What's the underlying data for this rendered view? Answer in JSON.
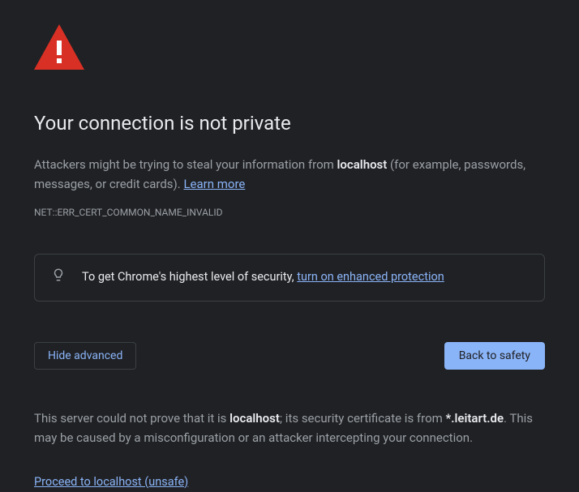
{
  "title": "Your connection is not private",
  "description": {
    "prefix": "Attackers might be trying to steal your information from ",
    "host": "localhost",
    "suffix": " (for example, passwords, messages, or credit cards). ",
    "learn_more": "Learn more"
  },
  "error_code": "NET::ERR_CERT_COMMON_NAME_INVALID",
  "tip": {
    "prefix": "To get Chrome's highest level of security, ",
    "link_text": "turn on enhanced protection"
  },
  "buttons": {
    "hide_advanced": "Hide advanced",
    "back_to_safety": "Back to safety"
  },
  "advanced": {
    "prefix": "This server could not prove that it is ",
    "host": "localhost",
    "mid": "; its security certificate is from ",
    "cert_domain": "*.leitart.de",
    "suffix": ". This may be caused by a misconfiguration or an attacker intercepting your connection."
  },
  "proceed_link": "Proceed to localhost (unsafe)"
}
